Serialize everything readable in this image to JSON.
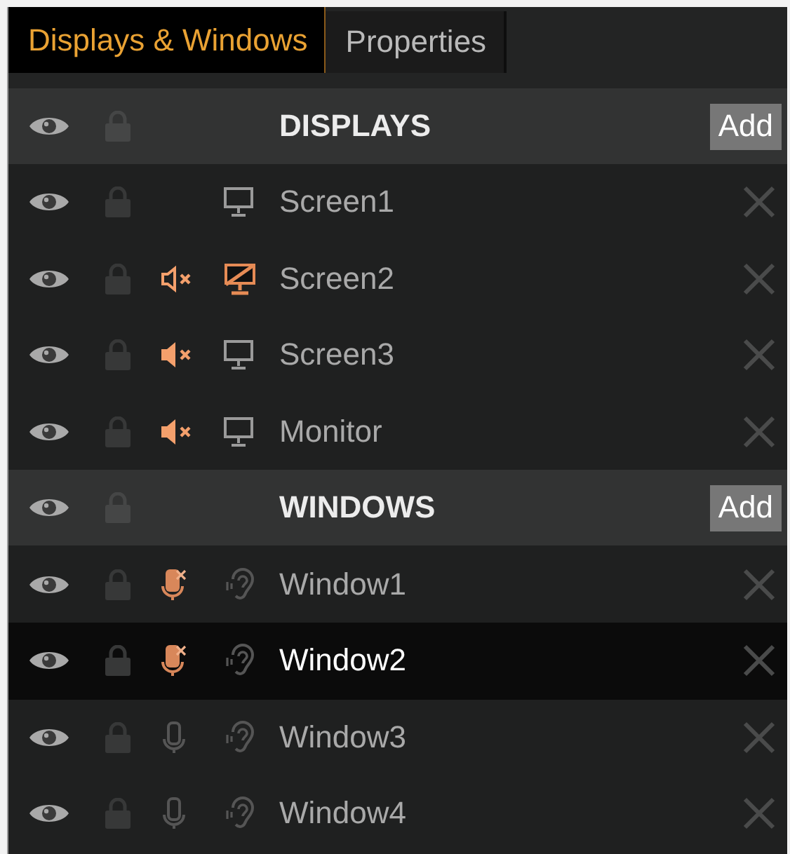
{
  "tabs": [
    {
      "label": "Displays & Windows",
      "selected": true
    },
    {
      "label": "Properties",
      "selected": false
    }
  ],
  "sections": [
    {
      "kind": "displays",
      "title": "DISPLAYS",
      "add_button": "Add",
      "items": [
        {
          "name": "Screen1",
          "speaker_muted": false,
          "display_off": false,
          "selected": false
        },
        {
          "name": "Screen2",
          "speaker_muted": true,
          "speaker_filled": false,
          "display_off": true,
          "selected": false
        },
        {
          "name": "Screen3",
          "speaker_muted": true,
          "speaker_filled": true,
          "display_off": false,
          "selected": false
        },
        {
          "name": "Monitor",
          "speaker_muted": true,
          "speaker_filled": true,
          "display_off": false,
          "selected": false
        }
      ]
    },
    {
      "kind": "windows",
      "title": "WINDOWS",
      "add_button": "Add",
      "items": [
        {
          "name": "Window1",
          "mic_muted": true,
          "selected": false
        },
        {
          "name": "Window2",
          "mic_muted": true,
          "selected": true
        },
        {
          "name": "Window3",
          "mic_muted": false,
          "selected": false
        },
        {
          "name": "Window4",
          "mic_muted": false,
          "selected": false
        }
      ]
    }
  ]
}
